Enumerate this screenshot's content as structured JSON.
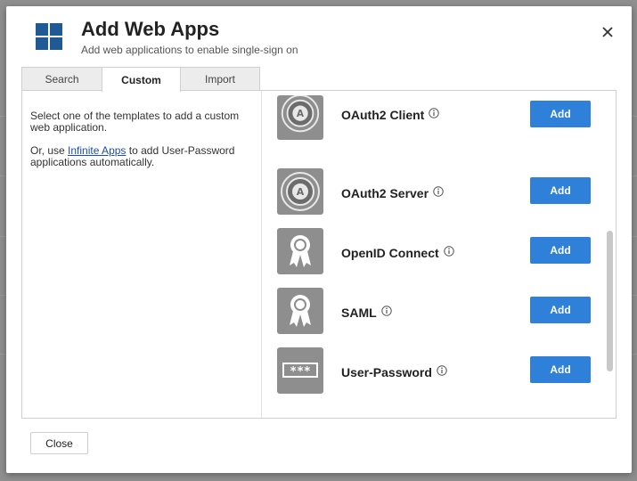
{
  "dialog": {
    "title": "Add Web Apps",
    "subtitle": "Add web applications to enable single-sign on",
    "logo_icon": "windows-grid-icon",
    "close_icon": "close-icon"
  },
  "tabs": [
    {
      "label": "Search",
      "active": false
    },
    {
      "label": "Custom",
      "active": true
    },
    {
      "label": "Import",
      "active": false
    }
  ],
  "left_pane": {
    "instruction": "Select one of the templates to add a custom web application.",
    "alt_prefix": "Or, use ",
    "alt_link": "Infinite Apps",
    "alt_suffix": " to add User-Password applications automatically."
  },
  "apps": [
    {
      "name": "OAuth2 Client",
      "icon": "oauth-badge-icon",
      "button": "Add"
    },
    {
      "name": "OAuth2 Server",
      "icon": "oauth-badge-icon",
      "button": "Add"
    },
    {
      "name": "OpenID Connect",
      "icon": "ribbon-award-icon",
      "button": "Add"
    },
    {
      "name": "SAML",
      "icon": "ribbon-award-icon",
      "button": "Add"
    },
    {
      "name": "User-Password",
      "icon": "password-field-icon",
      "button": "Add"
    }
  ],
  "footer": {
    "close_label": "Close"
  },
  "colors": {
    "accent": "#2f80d8",
    "logo": "#1f5a94",
    "tile": "#8e8e8e"
  }
}
